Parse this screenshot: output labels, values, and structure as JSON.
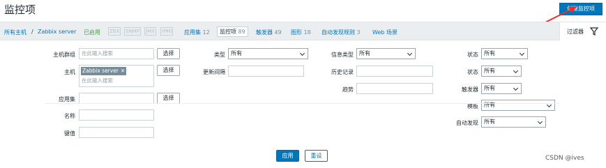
{
  "header": {
    "title": "监控项",
    "create_button": "创建监控项"
  },
  "nav": {
    "all_hosts": "所有主机",
    "separator": "/",
    "host": "Zabbix server",
    "status": "已启用",
    "badges": [
      "ZBX",
      "SNMP",
      "JMX",
      "IPMI"
    ],
    "tabs": [
      {
        "label": "应用集",
        "count": "12"
      },
      {
        "label": "监控项",
        "count": "89"
      },
      {
        "label": "触发器",
        "count": "49"
      },
      {
        "label": "图形",
        "count": "18"
      },
      {
        "label": "自动发现规则",
        "count": "3"
      },
      {
        "label": "Web 场景",
        "count": ""
      }
    ],
    "filter_tab": "过滤器"
  },
  "filter": {
    "host_group": {
      "label": "主机群组",
      "placeholder": "在此输入搜索",
      "button": "选择"
    },
    "host": {
      "label": "主机",
      "chip": "Zabbix server",
      "placeholder": "在此输入搜索",
      "button": "选择"
    },
    "application": {
      "label": "应用集",
      "button": "选择"
    },
    "name": {
      "label": "名称"
    },
    "key": {
      "label": "键值"
    },
    "type": {
      "label": "类型",
      "value": "所有"
    },
    "interval": {
      "label": "更新间隔"
    },
    "info_type": {
      "label": "信息类型",
      "value": "所有"
    },
    "history": {
      "label": "历史记录"
    },
    "trends": {
      "label": "趋势"
    },
    "state1": {
      "label": "状态",
      "value": "所有"
    },
    "state2": {
      "label": "状态",
      "value": "所有"
    },
    "triggers": {
      "label": "触发器",
      "value": "所有"
    },
    "template": {
      "label": "模板",
      "value": "所有"
    },
    "discovery": {
      "label": "自动发现",
      "value": "所有"
    },
    "apply": "应用",
    "reset": "重设"
  },
  "watermark": "CSDN @ives",
  "bottom_text": "..."
}
